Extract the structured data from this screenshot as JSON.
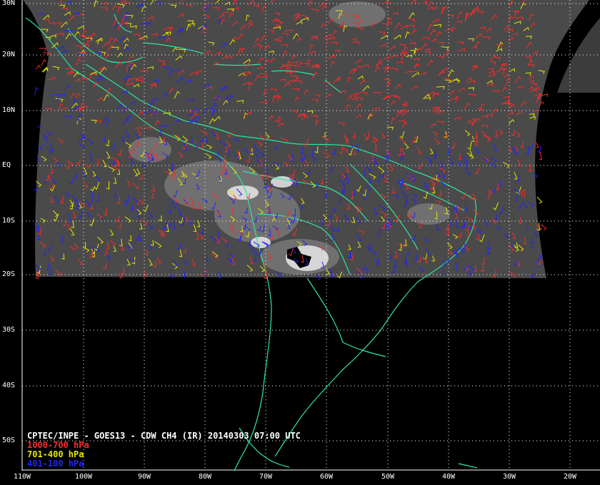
{
  "title": "CPTEC/INPE - GOES13 - CDW CH4 (IR) 20140303 07:00 UTC",
  "legend": [
    {
      "label": "1000-700 hPa",
      "color": "#ff2a2a"
    },
    {
      "label": "701-400 hPa",
      "color": "#e6e600"
    },
    {
      "label": "401-100 hPa",
      "color": "#2323ff"
    }
  ],
  "lat_labels": [
    "30N",
    "20N",
    "10N",
    "EQ",
    "10S",
    "20S",
    "30S",
    "40S",
    "50S"
  ],
  "lon_labels": [
    "110W",
    "100W",
    "90W",
    "80W",
    "70W",
    "60W",
    "50W",
    "40W",
    "30W",
    "20W"
  ],
  "colors": {
    "coastline": "#2ee6a0",
    "grid": "#ffffff",
    "background": "#000000",
    "satellite": "#4a4a4a"
  }
}
